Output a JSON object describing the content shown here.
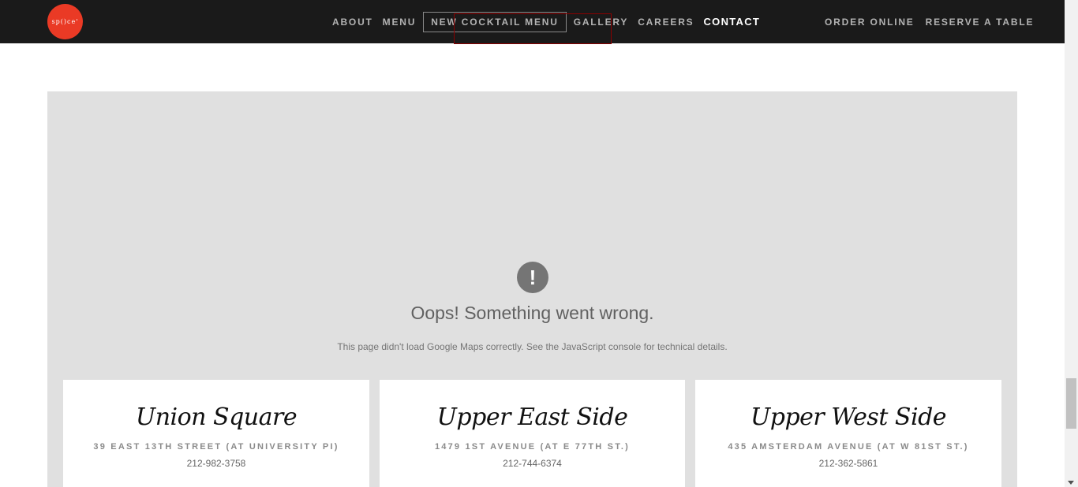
{
  "brand": {
    "logo_text": "sp()ce'",
    "accent": "#ea3a25"
  },
  "nav": {
    "main": [
      {
        "label": "ABOUT"
      },
      {
        "label": "MENU"
      },
      {
        "label": "NEW COCKTAIL MENU"
      },
      {
        "label": "GALLERY"
      },
      {
        "label": "CAREERS"
      },
      {
        "label": "CONTACT"
      }
    ],
    "right": [
      {
        "label": "ORDER ONLINE"
      },
      {
        "label": "RESERVE A TABLE"
      }
    ]
  },
  "map_error": {
    "icon": "!",
    "title": "Oops! Something went wrong.",
    "description": "This page didn't load Google Maps correctly. See the JavaScript console for technical details."
  },
  "locations": [
    {
      "name": "Union Square",
      "address": "39 EAST 13TH STREET (AT UNIVERSITY PI)",
      "phone": "212-982-3758"
    },
    {
      "name": "Upper East Side",
      "address": "1479 1ST AVENUE (AT E 77TH ST.)",
      "phone": "212-744-6374"
    },
    {
      "name": "Upper West Side",
      "address": "435 AMSTERDAM AVENUE (AT W 81ST ST.)",
      "phone": "212-362-5861"
    }
  ]
}
